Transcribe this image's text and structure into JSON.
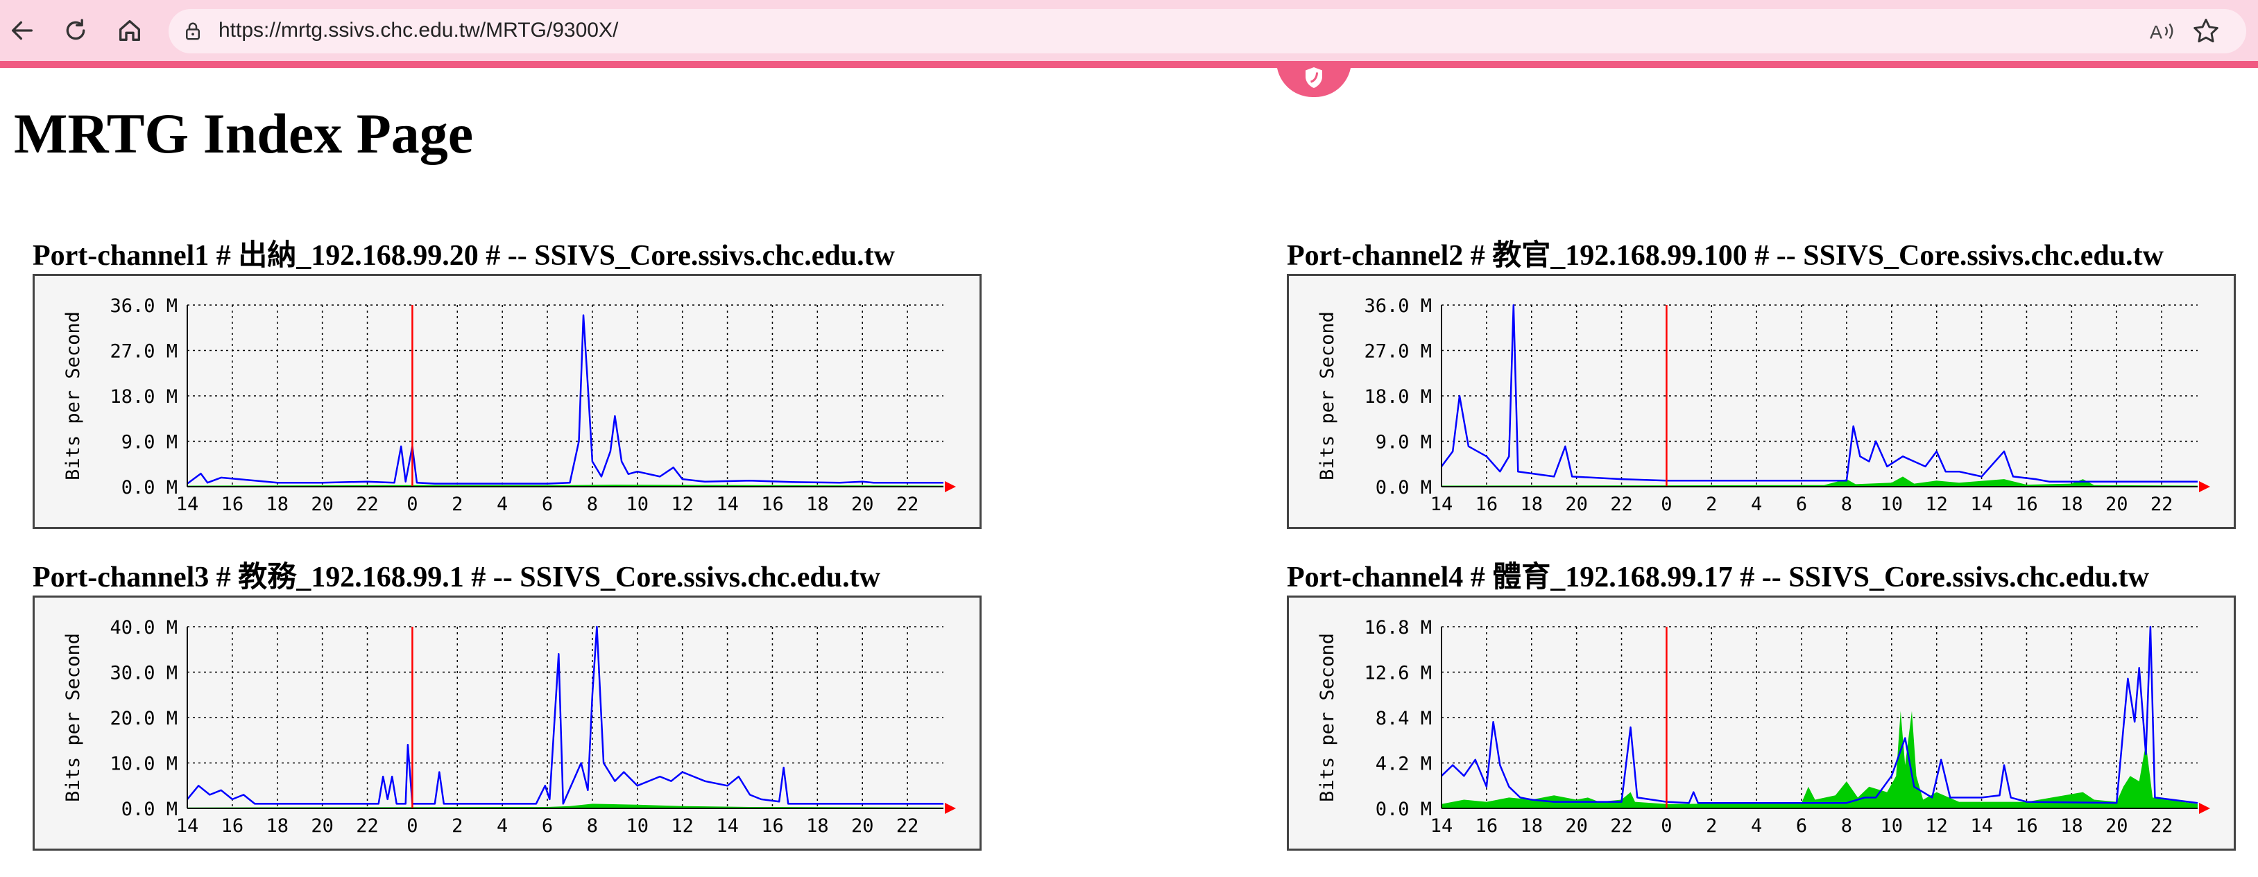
{
  "browser": {
    "url": "https://mrtg.ssivs.chc.edu.tw/MRTG/9300X/",
    "icons": [
      "back-arrow-icon",
      "refresh-icon",
      "home-icon",
      "lock-icon",
      "read-aloud-icon",
      "favorite-star-icon",
      "shield-icon"
    ]
  },
  "page": {
    "title": "MRTG Index Page"
  },
  "colors": {
    "in": "#00cc00",
    "out": "#0000ff",
    "now": "#ff0000",
    "axis": "#000000",
    "grid": "#000000",
    "bg": "#f5f5f5"
  },
  "chart_data": [
    {
      "type": "area",
      "title": "Port-channel1 # 出納_192.168.99.20 # -- SSIVS_Core.ssivs.chc.edu.tw",
      "ylabel": "Bits per Second",
      "y_ticks": [
        "0.0 M",
        "9.0 M",
        "18.0 M",
        "27.0 M",
        "36.0 M"
      ],
      "ylim": [
        0,
        36
      ],
      "x_ticks": [
        "14",
        "16",
        "18",
        "20",
        "22",
        "0",
        "2",
        "4",
        "6",
        "8",
        "10",
        "12",
        "14",
        "16",
        "18",
        "20",
        "22"
      ],
      "xlim": [
        0,
        33.6
      ],
      "now_marker": 10,
      "series": [
        {
          "kind": "in",
          "points": [
            [
              0,
              0.2
            ],
            [
              10,
              0.3
            ],
            [
              17,
              0.3
            ],
            [
              19,
              0.4
            ],
            [
              25,
              0.3
            ],
            [
              33.6,
              0.2
            ]
          ]
        },
        {
          "kind": "out",
          "points": [
            [
              0,
              0.6
            ],
            [
              0.6,
              2.6
            ],
            [
              0.9,
              0.8
            ],
            [
              1.5,
              1.8
            ],
            [
              3,
              1.2
            ],
            [
              4,
              0.8
            ],
            [
              6,
              0.8
            ],
            [
              8,
              1
            ],
            [
              9.2,
              0.8
            ],
            [
              9.5,
              8
            ],
            [
              9.7,
              1
            ],
            [
              10,
              8
            ],
            [
              10.2,
              0.8
            ],
            [
              11,
              0.6
            ],
            [
              16,
              0.6
            ],
            [
              17,
              0.8
            ],
            [
              17.4,
              9
            ],
            [
              17.6,
              34
            ],
            [
              17.8,
              20
            ],
            [
              18,
              5
            ],
            [
              18.4,
              2
            ],
            [
              18.8,
              7
            ],
            [
              19,
              14
            ],
            [
              19.3,
              5
            ],
            [
              19.6,
              2.5
            ],
            [
              20,
              3
            ],
            [
              21,
              2
            ],
            [
              21.6,
              3.8
            ],
            [
              22,
              1.5
            ],
            [
              23,
              1
            ],
            [
              25,
              1.2
            ],
            [
              27,
              0.9
            ],
            [
              29,
              0.8
            ],
            [
              30,
              1
            ],
            [
              30.5,
              0.8
            ],
            [
              33.6,
              0.8
            ]
          ]
        }
      ]
    },
    {
      "type": "area",
      "title": "Port-channel2 # 教官_192.168.99.100 # -- SSIVS_Core.ssivs.chc.edu.tw",
      "ylabel": "Bits per Second",
      "y_ticks": [
        "0.0 M",
        "9.0 M",
        "18.0 M",
        "27.0 M",
        "36.0 M"
      ],
      "ylim": [
        0,
        36
      ],
      "x_ticks": [
        "14",
        "16",
        "18",
        "20",
        "22",
        "0",
        "2",
        "4",
        "6",
        "8",
        "10",
        "12",
        "14",
        "16",
        "18",
        "20",
        "22"
      ],
      "xlim": [
        0,
        33.6
      ],
      "now_marker": 10,
      "series": [
        {
          "kind": "in",
          "points": [
            [
              0,
              0.2
            ],
            [
              17,
              0.3
            ],
            [
              18,
              1.5
            ],
            [
              18.4,
              0.5
            ],
            [
              20,
              0.8
            ],
            [
              20.5,
              2
            ],
            [
              21,
              0.6
            ],
            [
              22,
              1.2
            ],
            [
              23,
              0.8
            ],
            [
              25,
              1.5
            ],
            [
              26,
              0.4
            ],
            [
              28,
              0.6
            ],
            [
              28.5,
              1.5
            ],
            [
              29,
              0.3
            ],
            [
              33.6,
              0.2
            ]
          ]
        },
        {
          "kind": "out",
          "points": [
            [
              0,
              4
            ],
            [
              0.5,
              7
            ],
            [
              0.8,
              18
            ],
            [
              1.2,
              8
            ],
            [
              2,
              6
            ],
            [
              2.6,
              3
            ],
            [
              3,
              6
            ],
            [
              3.2,
              36
            ],
            [
              3.4,
              3
            ],
            [
              5,
              2
            ],
            [
              5.5,
              8
            ],
            [
              5.8,
              2
            ],
            [
              8,
              1.5
            ],
            [
              10,
              1.2
            ],
            [
              18,
              1.2
            ],
            [
              18.3,
              12
            ],
            [
              18.6,
              6
            ],
            [
              19,
              5
            ],
            [
              19.3,
              9
            ],
            [
              19.8,
              4
            ],
            [
              20.5,
              6
            ],
            [
              21,
              5
            ],
            [
              21.5,
              4
            ],
            [
              22,
              7
            ],
            [
              22.4,
              3
            ],
            [
              23,
              3
            ],
            [
              24,
              2
            ],
            [
              25,
              7
            ],
            [
              25.4,
              2
            ],
            [
              26.4,
              1.5
            ],
            [
              27,
              1
            ],
            [
              33.6,
              1
            ]
          ]
        }
      ]
    },
    {
      "type": "area",
      "title": "Port-channel3 # 教務_192.168.99.1 # -- SSIVS_Core.ssivs.chc.edu.tw",
      "ylabel": "Bits per Second",
      "y_ticks": [
        "0.0 M",
        "10.0 M",
        "20.0 M",
        "30.0 M",
        "40.0 M"
      ],
      "ylim": [
        0,
        40
      ],
      "x_ticks": [
        "14",
        "16",
        "18",
        "20",
        "22",
        "0",
        "2",
        "4",
        "6",
        "8",
        "10",
        "12",
        "14",
        "16",
        "18",
        "20",
        "22"
      ],
      "xlim": [
        0,
        33.6
      ],
      "now_marker": 10,
      "series": [
        {
          "kind": "in",
          "points": [
            [
              0,
              0.2
            ],
            [
              16,
              0.3
            ],
            [
              17,
              0.5
            ],
            [
              18,
              1
            ],
            [
              20,
              0.8
            ],
            [
              22,
              0.5
            ],
            [
              25,
              0.3
            ],
            [
              33.6,
              0.2
            ]
          ]
        },
        {
          "kind": "out",
          "points": [
            [
              0,
              2
            ],
            [
              0.5,
              5
            ],
            [
              1,
              3
            ],
            [
              1.5,
              4
            ],
            [
              2,
              2
            ],
            [
              2.5,
              3
            ],
            [
              3,
              1
            ],
            [
              8.5,
              1
            ],
            [
              8.7,
              7
            ],
            [
              8.9,
              2
            ],
            [
              9.1,
              7
            ],
            [
              9.3,
              1
            ],
            [
              9.7,
              1
            ],
            [
              9.8,
              14
            ],
            [
              10,
              1
            ],
            [
              11,
              1
            ],
            [
              11.2,
              8
            ],
            [
              11.4,
              1
            ],
            [
              15.5,
              1
            ],
            [
              15.9,
              5
            ],
            [
              16.1,
              2
            ],
            [
              16.5,
              34
            ],
            [
              16.7,
              1
            ],
            [
              17.5,
              10
            ],
            [
              17.8,
              4
            ],
            [
              18,
              25
            ],
            [
              18.2,
              40
            ],
            [
              18.5,
              10
            ],
            [
              19,
              6
            ],
            [
              19.4,
              8
            ],
            [
              20,
              5
            ],
            [
              21,
              7
            ],
            [
              21.5,
              6
            ],
            [
              22,
              8
            ],
            [
              23,
              6
            ],
            [
              24,
              5
            ],
            [
              24.5,
              7
            ],
            [
              25,
              3
            ],
            [
              25.5,
              2
            ],
            [
              26.3,
              1.5
            ],
            [
              26.5,
              9
            ],
            [
              26.7,
              1
            ],
            [
              33.6,
              1
            ]
          ]
        }
      ]
    },
    {
      "type": "area",
      "title": "Port-channel4 # 體育_192.168.99.17 # -- SSIVS_Core.ssivs.chc.edu.tw",
      "ylabel": "Bits per Second",
      "y_ticks": [
        "0.0 M",
        "4.2 M",
        "8.4 M",
        "12.6 M",
        "16.8 M"
      ],
      "ylim": [
        0,
        16.8
      ],
      "x_ticks": [
        "14",
        "16",
        "18",
        "20",
        "22",
        "0",
        "2",
        "4",
        "6",
        "8",
        "10",
        "12",
        "14",
        "16",
        "18",
        "20",
        "22"
      ],
      "xlim": [
        0,
        33.6
      ],
      "now_marker": 10,
      "series": [
        {
          "kind": "in",
          "points": [
            [
              0,
              0.4
            ],
            [
              1,
              0.8
            ],
            [
              2,
              0.6
            ],
            [
              3,
              1
            ],
            [
              4,
              0.8
            ],
            [
              5,
              1.2
            ],
            [
              6,
              0.8
            ],
            [
              6.5,
              1
            ],
            [
              7,
              0.6
            ],
            [
              8,
              0.8
            ],
            [
              8.4,
              1.5
            ],
            [
              8.6,
              0.6
            ],
            [
              10,
              0.4
            ],
            [
              16,
              0.5
            ],
            [
              16.3,
              2
            ],
            [
              16.6,
              0.8
            ],
            [
              17.5,
              1.2
            ],
            [
              18,
              2.5
            ],
            [
              18.5,
              1
            ],
            [
              19,
              2
            ],
            [
              19.8,
              1.5
            ],
            [
              20.2,
              3
            ],
            [
              20.4,
              9
            ],
            [
              20.6,
              4
            ],
            [
              20.9,
              9
            ],
            [
              21.1,
              3
            ],
            [
              21.4,
              0.8
            ],
            [
              22,
              1.5
            ],
            [
              23,
              0.6
            ],
            [
              26,
              0.6
            ],
            [
              28.5,
              1.5
            ],
            [
              29,
              0.8
            ],
            [
              30,
              0.6
            ],
            [
              30.3,
              2
            ],
            [
              30.6,
              3
            ],
            [
              31,
              2.5
            ],
            [
              31.3,
              6
            ],
            [
              31.6,
              1
            ],
            [
              33.6,
              0.4
            ]
          ]
        },
        {
          "kind": "out",
          "points": [
            [
              0,
              3
            ],
            [
              0.5,
              4
            ],
            [
              1,
              3
            ],
            [
              1.5,
              4.5
            ],
            [
              2,
              2
            ],
            [
              2.3,
              8
            ],
            [
              2.6,
              4
            ],
            [
              3,
              2
            ],
            [
              3.5,
              1
            ],
            [
              4,
              0.8
            ],
            [
              5,
              0.6
            ],
            [
              8,
              0.6
            ],
            [
              8.4,
              7.5
            ],
            [
              8.7,
              1
            ],
            [
              10,
              0.6
            ],
            [
              11,
              0.5
            ],
            [
              11.2,
              1.5
            ],
            [
              11.4,
              0.5
            ],
            [
              16,
              0.5
            ],
            [
              18,
              0.5
            ],
            [
              18.8,
              1
            ],
            [
              19.3,
              1
            ],
            [
              20,
              3
            ],
            [
              20.6,
              6.5
            ],
            [
              21,
              2
            ],
            [
              21.8,
              1
            ],
            [
              22.2,
              4.5
            ],
            [
              22.6,
              1
            ],
            [
              24,
              1
            ],
            [
              24.8,
              1.2
            ],
            [
              25,
              4
            ],
            [
              25.3,
              1
            ],
            [
              26,
              0.6
            ],
            [
              30,
              0.5
            ],
            [
              30.5,
              12
            ],
            [
              30.8,
              8
            ],
            [
              31,
              13
            ],
            [
              31.3,
              5
            ],
            [
              31.5,
              16.8
            ],
            [
              31.7,
              1
            ],
            [
              33.6,
              0.5
            ]
          ]
        }
      ]
    }
  ]
}
